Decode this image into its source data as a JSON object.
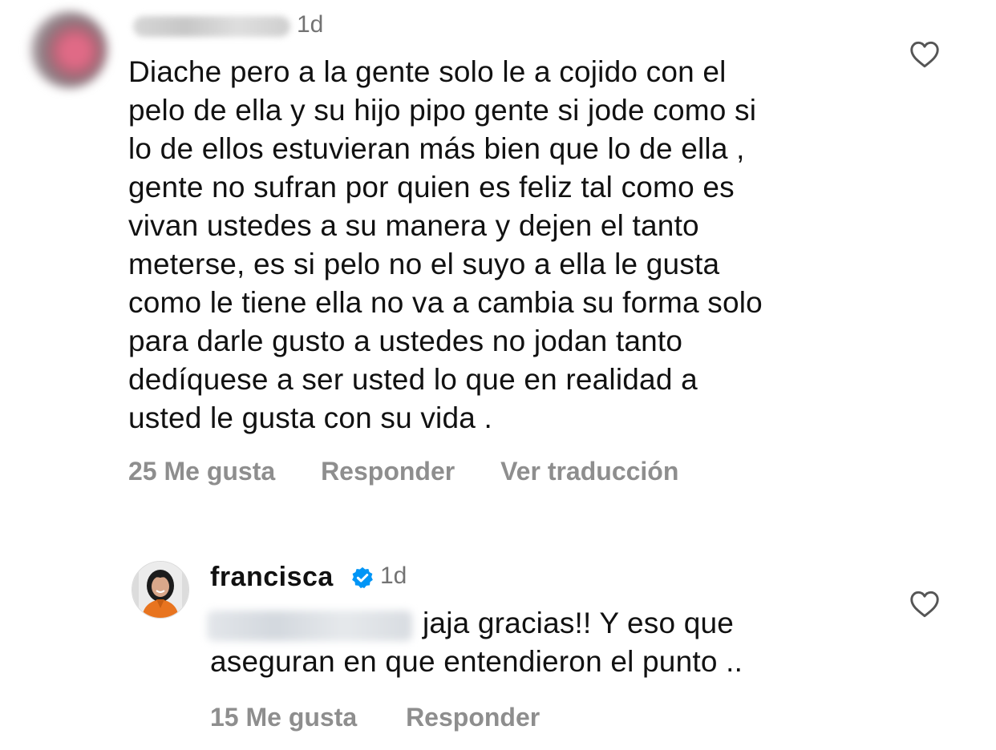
{
  "comments": [
    {
      "time": "1d",
      "lines": [
        "Diache pero a la gente solo le a cojido con el",
        "pelo de ella y su hijo pipo gente si jode como si",
        "lo de ellos estuvieran más bien que lo de ella ,",
        "gente no sufran por quien es feliz tal como es",
        "vivan ustedes a su manera y dejen el tanto",
        "meterse, es si pelo no el suyo a ella le gusta",
        "como le tiene ella no va a cambia su forma solo",
        "para darle gusto a ustedes no jodan tanto",
        "dedíquese a ser usted lo que en realidad a",
        "usted le gusta con su vida ."
      ],
      "likes": "25 Me gusta",
      "reply": "Responder",
      "translate": "Ver traducción"
    },
    {
      "username": "francisca",
      "verified": true,
      "time": "1d",
      "lines": [
        "jaja gracias!! Y eso que",
        "aseguran en que entendieron el punto .."
      ],
      "likes": "15 Me gusta",
      "reply": "Responder"
    }
  ],
  "icons": {
    "like": "heart-outline-icon",
    "verified": "verified-badge-icon"
  },
  "colors": {
    "text": "#111111",
    "muted": "#8e8e8e",
    "time": "#737373",
    "verified": "#0095f6"
  }
}
